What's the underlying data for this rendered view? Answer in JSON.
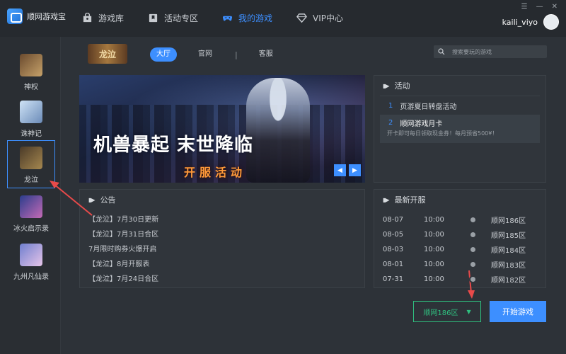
{
  "app": {
    "title": "顺网游戏宝"
  },
  "nav": [
    {
      "label": "游戏库",
      "icon": "store-icon"
    },
    {
      "label": "活动专区",
      "icon": "bookmark-icon"
    },
    {
      "label": "我的游戏",
      "icon": "gamepad-icon",
      "active": true
    },
    {
      "label": "VIP中心",
      "icon": "diamond-icon"
    }
  ],
  "user": {
    "name": "kaili_viyo"
  },
  "sidebar": {
    "items": [
      {
        "label": "神权",
        "colors": [
          "#6a4a2e",
          "#c6a26a"
        ]
      },
      {
        "label": "诛神记",
        "colors": [
          "#cfe3f6",
          "#6b8bb8"
        ]
      },
      {
        "label": "龙泣",
        "colors": [
          "#4a3a28",
          "#a5874f"
        ],
        "active": true
      },
      {
        "label": "冰火启示录",
        "colors": [
          "#2b3d8c",
          "#c46ab6"
        ]
      },
      {
        "label": "九州凡仙录",
        "colors": [
          "#6f7fcf",
          "#e6c4e8"
        ]
      }
    ]
  },
  "game": {
    "logo_text": "龙泣"
  },
  "tabs": {
    "lobby": "大厅",
    "official": "官网",
    "separator": "|",
    "service": "客服"
  },
  "search": {
    "placeholder": "搜索要玩的游戏"
  },
  "banner": {
    "title": "机兽暴起  末世降临",
    "subtitle": "开服活动"
  },
  "activity": {
    "title": "活动",
    "items": [
      {
        "num": "1",
        "title": "页游夏日转盘活动"
      },
      {
        "num": "2",
        "title": "顺网游戏月卡",
        "desc": "开卡即可每日领取现金券！每月预省500¥！"
      }
    ]
  },
  "notice": {
    "title": "公告",
    "items": [
      "【龙泣】7月30日更新",
      "【龙泣】7月31日合区",
      "7月限时购券火爆开启",
      "【龙泣】8月开服表",
      "【龙泣】7月24日合区"
    ]
  },
  "servers": {
    "title": "最新开服",
    "rows": [
      {
        "date": "08-07",
        "time": "10:00",
        "name": "顺网186区"
      },
      {
        "date": "08-05",
        "time": "10:00",
        "name": "顺网185区"
      },
      {
        "date": "08-03",
        "time": "10:00",
        "name": "顺网184区"
      },
      {
        "date": "08-01",
        "time": "10:00",
        "name": "顺网183区"
      },
      {
        "date": "07-31",
        "time": "10:00",
        "name": "顺网182区"
      }
    ]
  },
  "server_select": {
    "value": "顺网186区"
  },
  "start_button": {
    "label": "开始游戏"
  },
  "colors": {
    "accent": "#3d8fff",
    "server_green": "#2fbf7f",
    "annotation_red": "#e84a4a"
  }
}
